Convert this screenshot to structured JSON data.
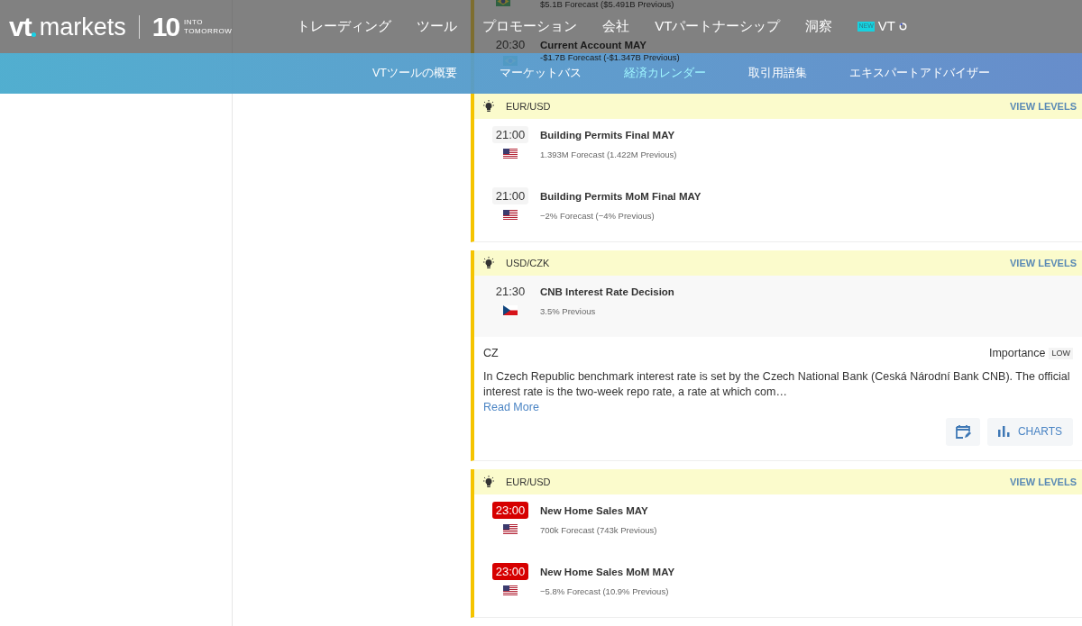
{
  "header": {
    "logo": {
      "brand_bold": "vt",
      "brand": "markets",
      "anniversary": "10",
      "tagline_1": "INTO",
      "tagline_2": "TOMORROW"
    },
    "nav": [
      {
        "label": "トレーディング"
      },
      {
        "label": "ツール"
      },
      {
        "label": "プロモーション"
      },
      {
        "label": "会社"
      },
      {
        "label": "VTパートナーシップ"
      },
      {
        "label": "洞察"
      },
      {
        "label": "VT",
        "badge": "NEW",
        "loading": true
      }
    ]
  },
  "subnav": [
    {
      "label": "VTツールの概要",
      "selected": false
    },
    {
      "label": "マーケットバス",
      "selected": false
    },
    {
      "label": "経済カレンダー",
      "selected": true
    },
    {
      "label": "取引用語集",
      "selected": false
    },
    {
      "label": "エキスパートアドバイザー",
      "selected": false
    }
  ],
  "previous_group": {
    "top_detail": "$5.1B Forecast ($5.491B Previous)",
    "top_flag": {
      "kind": "br"
    },
    "event": {
      "time": "20:30",
      "flag": {
        "kind": "br"
      },
      "title": "Current Account MAY",
      "detail": "-$1.7B Forecast (-$1.347B Previous)"
    }
  },
  "groups": [
    {
      "pair": "EUR/USD",
      "action": "VIEW LEVELS",
      "events": [
        {
          "time": "21:00",
          "highlighted": false,
          "flag": {
            "kind": "us"
          },
          "title": "Building Permits Final MAY",
          "detail": "1.393M Forecast (1.422M Previous)"
        },
        {
          "time": "21:00",
          "highlighted": false,
          "flag": {
            "kind": "us"
          },
          "title": "Building Permits MoM Final MAY",
          "detail": "−2% Forecast (−4% Previous)"
        }
      ]
    },
    {
      "pair": "USD/CZK",
      "action": "VIEW LEVELS",
      "events": [
        {
          "time": "21:30",
          "highlighted": false,
          "flag": {
            "kind": "cz"
          },
          "title": "CNB Interest Rate Decision",
          "detail": "3.5% Previous",
          "expanded": true,
          "info": {
            "country_code": "CZ",
            "importance_label": "Importance",
            "importance": "LOW",
            "description": "In Czech Republic benchmark interest rate is set by the Czech National Bank (Ceská Národní Bank CNB). The official interest rate is the two-week repo rate, a rate at which com…",
            "read_more": "Read More",
            "charts": "CHARTS"
          }
        }
      ]
    },
    {
      "pair": "EUR/USD",
      "action": "VIEW LEVELS",
      "events": [
        {
          "time": "23:00",
          "highlighted": true,
          "flag": {
            "kind": "us"
          },
          "title": "New Home Sales MAY",
          "detail": "700k Forecast (743k Previous)"
        },
        {
          "time": "23:00",
          "highlighted": true,
          "flag": {
            "kind": "us"
          },
          "title": "New Home Sales MoM MAY",
          "detail": "−5.8% Forecast (10.9% Previous)"
        }
      ]
    }
  ]
}
